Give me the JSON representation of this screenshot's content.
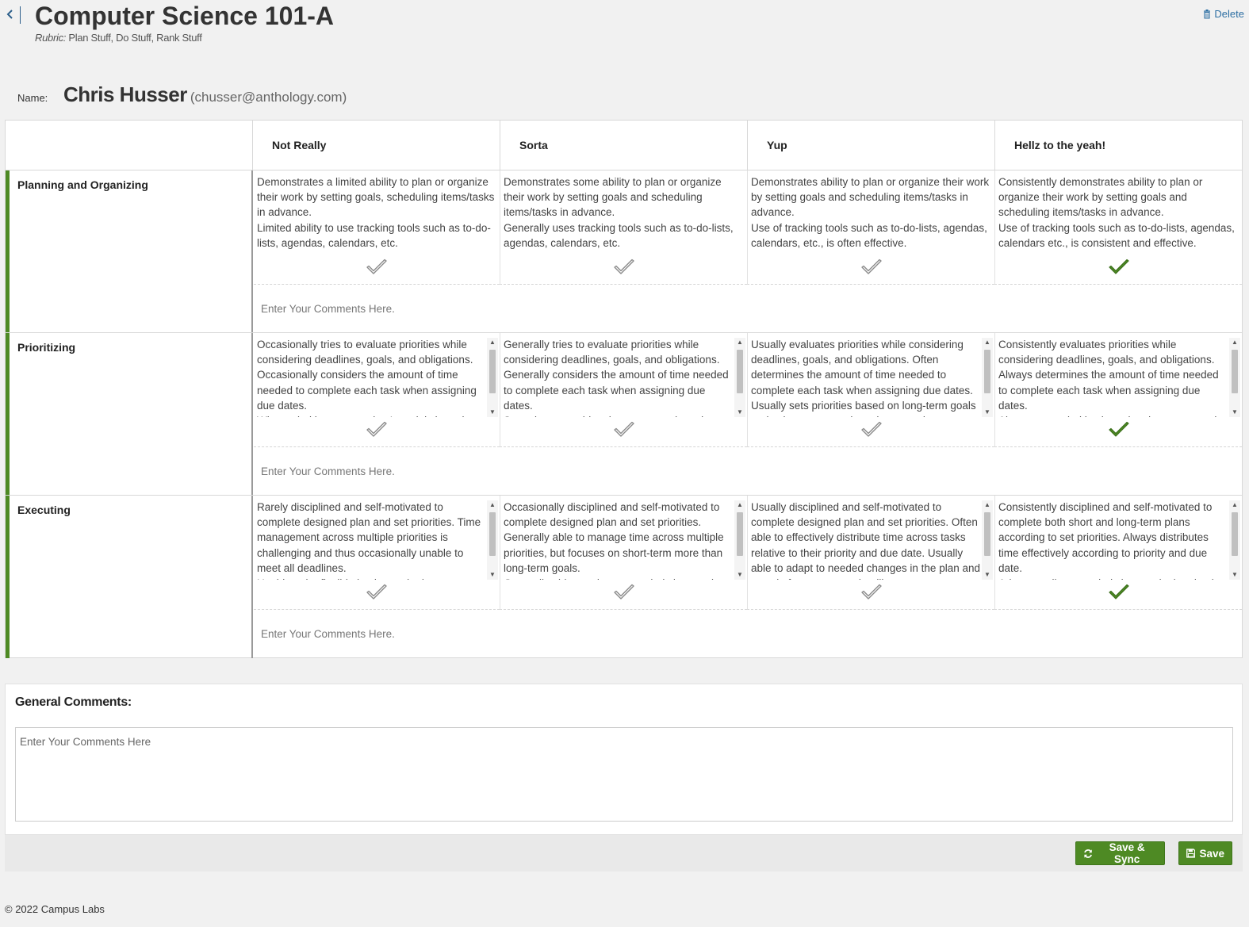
{
  "header": {
    "title": "Computer Science 101-A",
    "rubric_label": "Rubric:",
    "rubric_name": "Plan Stuff, Do Stuff, Rank Stuff",
    "delete_label": "Delete"
  },
  "student": {
    "name_label": "Name:",
    "name": "Chris Husser",
    "email": "(chusser@anthology.com)"
  },
  "levels": [
    "Not Really",
    "Sorta",
    "Yup",
    "Hellz to the yeah!"
  ],
  "criteria": [
    {
      "name": "Planning and Organizing",
      "selected_level": 3,
      "comment_placeholder": "Enter Your Comments Here.",
      "descriptions": [
        [
          "Demonstrates a limited ability to plan or organize their work by setting goals, scheduling items/tasks in advance.",
          "Limited ability to use tracking tools such as to-do-lists, agendas, calendars, etc."
        ],
        [
          "Demonstrates some ability to plan or organize their work by setting goals and scheduling items/tasks in advance.",
          "Generally uses tracking tools such as to-do-lists, agendas, calendars, etc."
        ],
        [
          "Demonstrates ability to plan or organize their work by setting goals and scheduling items/tasks in advance.",
          "Use of tracking tools such as to-do-lists, agendas, calendars, etc., is often effective."
        ],
        [
          "Consistently demonstrates ability to plan or organize their work by setting goals and scheduling items/tasks in advance.",
          "Use of tracking tools such as to-do-lists, agendas, calendars etc., is consistent and effective."
        ]
      ]
    },
    {
      "name": "Prioritizing",
      "selected_level": 3,
      "comment_placeholder": "Enter Your Comments Here.",
      "descriptions": [
        [
          "Occasionally tries to evaluate priorities while considering deadlines, goals, and obligations. Occasionally considers the amount of time needed to complete each task when assigning due dates.",
          "When priorities are set, they're solely based on"
        ],
        [
          "Generally tries to evaluate priorities while considering deadlines, goals, and obligations. Generally considers the amount of time needed to complete each task when assigning due dates.",
          "Sometimes considers long-term goals and"
        ],
        [
          "Usually evaluates priorities while considering deadlines, goals, and obligations.  Often determines the amount of time needed to complete each task when assigning due dates. Usually sets priorities based on long-term goals and values more so than short-term interests."
        ],
        [
          "Consistently evaluates priorities while considering deadlines, goals, and obligations. Always determines the amount of time needed to complete each task when assigning due dates.",
          "Always sets priorities based on long-term goals"
        ]
      ]
    },
    {
      "name": "Executing",
      "selected_level": 3,
      "comment_placeholder": "Enter Your Comments Here.",
      "descriptions": [
        [
          "Rarely disciplined and self-motivated to complete designed plan and set priorities. Time management across multiple priorities is challenging and thus occasionally unable to meet all deadlines.",
          "Unable to be flexible in plan and adapt to"
        ],
        [
          "Occasionally disciplined and self-motivated to complete designed plan and set priorities. Generally able to manage time across multiple priorities, but focuses on short-term more than long-term goals.",
          "Generally able to adapt to needed changes in"
        ],
        [
          "Usually disciplined and self-motivated to complete designed plan and set priorities. Often able to effectively distribute time across tasks relative to their priority and due date. Usually able to adapt to needed changes in the plan and sustain focus to meet deadlines."
        ],
        [
          "Consistently disciplined and self-motivated to complete both short and long-term plans according to set priorities. Always distributes time effectively according to priority and due date.",
          "Adapts easily to needed changes in the plan in"
        ]
      ]
    }
  ],
  "general_comments": {
    "title": "General Comments:",
    "placeholder": "Enter Your Comments Here"
  },
  "buttons": {
    "save_sync": "Save & Sync",
    "save": "Save"
  },
  "footer": {
    "copyright": "© 2022 Campus Labs"
  },
  "colors": {
    "accent_green": "#4e8a24",
    "check_selected": "#4e8a24",
    "check_unselected": "#8a8a8a",
    "link_blue": "#2d6fa3"
  },
  "icons": {
    "back": "chevron-left-icon",
    "delete": "trash-icon",
    "check": "checkmark-icon",
    "sync": "refresh-icon",
    "save": "floppy-disk-icon"
  }
}
